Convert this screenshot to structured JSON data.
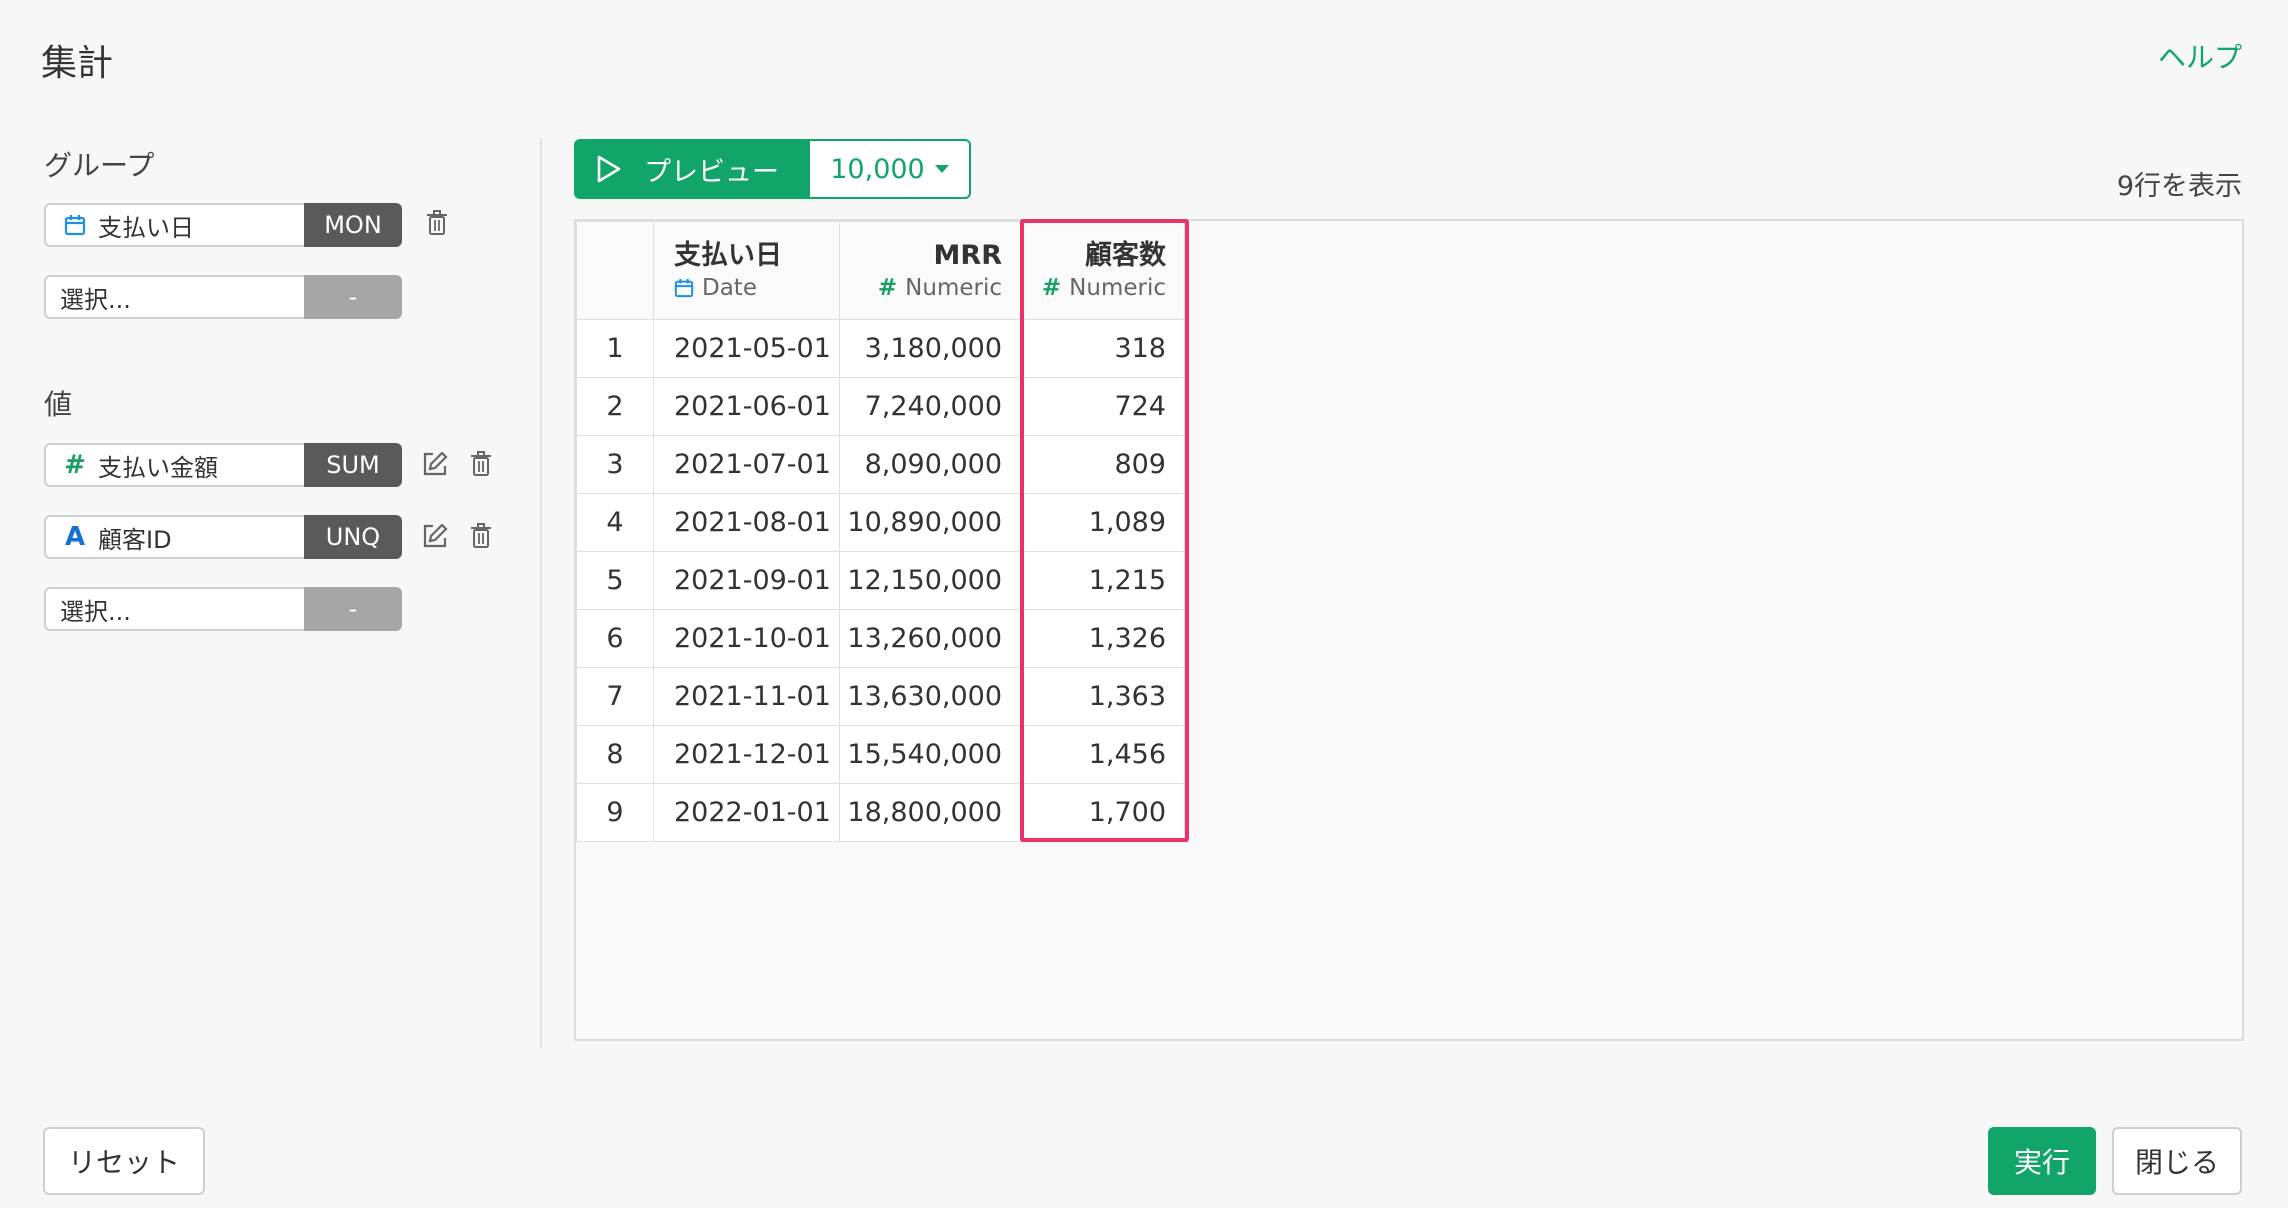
{
  "dialog": {
    "title": "集計",
    "help_label": "ヘルプ"
  },
  "group_section": {
    "label": "グループ",
    "fields": [
      {
        "name": "支払い日",
        "icon": "calendar-icon",
        "agg": "MON"
      },
      {
        "name": "選択...",
        "icon": "",
        "agg": "-"
      }
    ]
  },
  "value_section": {
    "label": "値",
    "fields": [
      {
        "name": "支払い金額",
        "icon": "hash-icon",
        "agg": "SUM"
      },
      {
        "name": "顧客ID",
        "icon": "text-type-icon",
        "icon_glyph": "A",
        "agg": "UNQ"
      },
      {
        "name": "選択...",
        "icon": "",
        "agg": "-"
      }
    ]
  },
  "preview": {
    "button_label": "プレビュー",
    "limit": "10,000",
    "row_count": "9行を表示"
  },
  "table": {
    "columns": [
      {
        "name": "支払い日",
        "type": "Date"
      },
      {
        "name": "MRR",
        "type": "Numeric"
      },
      {
        "name": "顧客数",
        "type": "Numeric"
      }
    ],
    "rows": [
      [
        "1",
        "2021-05-01",
        "3,180,000",
        "318"
      ],
      [
        "2",
        "2021-06-01",
        "7,240,000",
        "724"
      ],
      [
        "3",
        "2021-07-01",
        "8,090,000",
        "809"
      ],
      [
        "4",
        "2021-08-01",
        "10,890,000",
        "1,089"
      ],
      [
        "5",
        "2021-09-01",
        "12,150,000",
        "1,215"
      ],
      [
        "6",
        "2021-10-01",
        "13,260,000",
        "1,326"
      ],
      [
        "7",
        "2021-11-01",
        "13,630,000",
        "1,363"
      ],
      [
        "8",
        "2021-12-01",
        "15,540,000",
        "1,456"
      ],
      [
        "9",
        "2022-01-01",
        "18,800,000",
        "1,700"
      ]
    ]
  },
  "footer": {
    "reset_label": "リセット",
    "run_label": "実行",
    "close_label": "閉じる"
  },
  "colors": {
    "accent": "#12a56a",
    "highlight": "#e8336b",
    "date_icon": "#1f8fe0",
    "text_icon": "#1a6fd6"
  }
}
